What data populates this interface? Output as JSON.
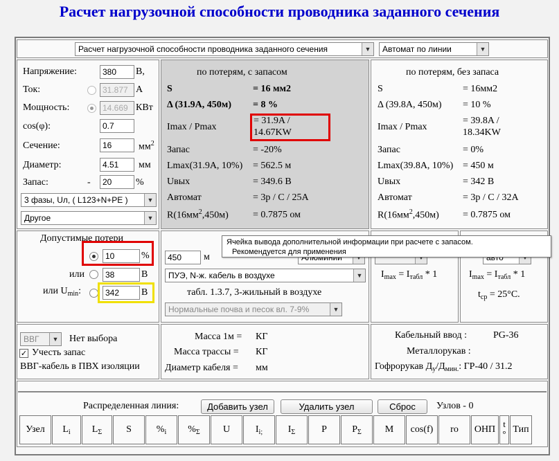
{
  "title": "Расчет нагрузочной способности проводника заданного сечения",
  "top_selects": {
    "calc_mode": "Расчет нагрузочной способности проводника заданного сечения",
    "protection": "Автомат по линии"
  },
  "inputs": {
    "voltage_label": "Напряжение:",
    "voltage": "380",
    "voltage_unit": "В,",
    "current_label": "Ток:",
    "current": "31.877",
    "current_unit": "А",
    "power_label": "Мощность:",
    "power": "14.669",
    "power_unit": "КВт",
    "cos_label": "cos(φ):",
    "cos": "0.7",
    "section_label": "Сечение:",
    "section": "16",
    "section_unit": "мм",
    "diameter_label": "Диаметр:",
    "diameter": "4.51",
    "diameter_unit": "мм",
    "reserve_label": "Запас:",
    "reserve_dash": "-",
    "reserve": "20",
    "reserve_unit": "%",
    "phase_select": "3 фазы, Uл, ( L123+N+PE )",
    "material_select": "Другое"
  },
  "with_reserve": {
    "header": "по потерям, с запасом",
    "rows": [
      [
        "S",
        "= 16 мм2"
      ],
      [
        "Δ (31.9А, 450м)",
        "= 8 %"
      ],
      [
        "Imax / Pmax",
        "= 31.9A / 14.67KW"
      ],
      [
        "Запас",
        "= -20%"
      ],
      [
        "Lmax(31.9A, 10%)",
        "= 562.5 м"
      ],
      [
        "Uвых",
        "= 349.6 В"
      ],
      [
        "Автомат",
        "= 3р / С / 25А"
      ],
      [
        "R(16мм",
        "= 0.7875 ом"
      ]
    ],
    "r_tail": ",450м)"
  },
  "without_reserve": {
    "header": "по потерям, без запаса",
    "rows": [
      [
        "S",
        "= 16мм2"
      ],
      [
        "Δ (39.8А, 450м)",
        "= 10 %"
      ],
      [
        "Imax / Pmax",
        "= 39.8A / 18.34KW"
      ],
      [
        "Запас",
        "= 0%"
      ],
      [
        "Lmax(39.8A, 10%)",
        "= 450 м"
      ],
      [
        "Uвых",
        "= 342 В"
      ],
      [
        "Автомат",
        "= 3р / С / 32А"
      ],
      [
        "R(16мм",
        "= 0.7875 ом"
      ]
    ],
    "r_tail": ",450м)"
  },
  "losses": {
    "header": "Допустимые потери",
    "percent": "10",
    "percent_unit": "%",
    "or1": "или",
    "volts": "38",
    "volts_unit": "В",
    "or2": "или U",
    "or2_sub": "min",
    "umin": "342",
    "umin_unit": "В"
  },
  "line": {
    "length": "450",
    "length_unit": "м",
    "material": "Алюминий",
    "method": "ПУЭ, N-ж. кабель в воздухе",
    "table_note": "табл. 1.3.7, 3-жильный в воздухе",
    "soil": "Нормальные почва и песок вл. 7-9%"
  },
  "formula": {
    "left": "I",
    "left_sub": "max",
    "eq": " = I",
    "tab_sub": "табл",
    "mult": " * 1",
    "temp": "t",
    "temp_sub": "ср",
    "temp_val": " = 25°С.",
    "auto_select": "авто"
  },
  "tooltip": {
    "line1": "Ячейка вывода дополнительной информации при расчете с запасом.",
    "line2": "Рекомендуется для применения"
  },
  "cable": {
    "type_select": "ВВГ",
    "no_choice": "Нет выбора",
    "reserve_check": "Учесть запас",
    "description": "ВВГ-кабель в ПВХ изоляции"
  },
  "mass": {
    "mass1m_label": "Масса 1м =",
    "mass1m_unit": "КГ",
    "route_label": "Масса трассы =",
    "route_unit": "КГ",
    "diam_label": "Диаметр кабеля =",
    "diam_unit": "мм"
  },
  "entry": {
    "cable_entry_label": "Кабельный ввод :",
    "cable_entry": "PG-36",
    "metal_sleeve_label": "Металлорукав :",
    "corr_label": "Гофрорукав Д",
    "corr_sub1": "у",
    "corr_sep": "/Д",
    "corr_sub2": "мин.",
    "corr_value": ": ГР-40 / 31.2"
  },
  "distributed": {
    "label": "Распределенная линия:",
    "add_node": "Добавить узел",
    "remove_node": "Удалить узел",
    "reset": "Сброс",
    "nodes": "Узлов - 0"
  },
  "table_headers": [
    {
      "t": "Узел"
    },
    {
      "t": "L",
      "s": "i"
    },
    {
      "t": "L",
      "s": "Σ"
    },
    {
      "t": "S"
    },
    {
      "t": "%",
      "s": "i"
    },
    {
      "t": "%",
      "s": "Σ"
    },
    {
      "t": "U"
    },
    {
      "t": "I",
      "s": "i;"
    },
    {
      "t": "I",
      "s": "Σ"
    },
    {
      "t": "P"
    },
    {
      "t": "P",
      "s": "Σ"
    },
    {
      "t": "M"
    },
    {
      "t": "cos(f)"
    },
    {
      "t": "ro"
    },
    {
      "t": "ОНП"
    },
    {
      "t": "t°"
    },
    {
      "t": "Тип"
    }
  ]
}
